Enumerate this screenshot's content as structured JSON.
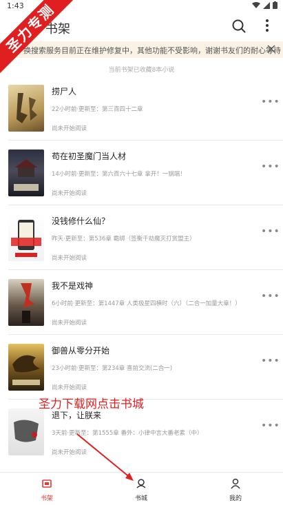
{
  "status": {
    "time": "1:43"
  },
  "appbar": {
    "title": "书架",
    "icons": [
      "search-icon",
      "more-vertical-icon"
    ]
  },
  "notice": {
    "text": "换搜索服务目前正在维护修复中，其他功能不受影响，谢谢书友们的耐心等待"
  },
  "shelf": {
    "count_text": "当前书架已收藏8本小说"
  },
  "books": [
    {
      "name": "捞尸人",
      "update": "22小时前·更新至：第三百四十二章",
      "state": "尚未开始阅读"
    },
    {
      "name": "苟在初圣魔门当人材",
      "update": "14小时前·更新至：第六百六十七章 拿开！一锅端！",
      "state": "尚未开始阅读"
    },
    {
      "name": "没钱修什么仙？",
      "update": "昨天·更新至：第536章 霸绑（签衡千劫魔灭打赏盟主）",
      "state": "尚未开始阅读"
    },
    {
      "name": "我不是戏神",
      "update": "6小时前·更新至：第1447章 人类极星四横时（六）（二合一加量大章！）",
      "state": "尚未开始阅读"
    },
    {
      "name": "御兽从零分开始",
      "update": "23小时前·更新至：第234章 喜前交流(二合一)",
      "state": "尚未开始阅读"
    },
    {
      "name": "退下，让朕来",
      "update": "3天前·更新至：第1555章 番外：小律中言大番老素（中）",
      "state": "尚未开始阅读"
    }
  ],
  "tabs": [
    {
      "label": "书架",
      "icon": "bookshelf-icon",
      "active": true
    },
    {
      "label": "书城",
      "icon": "bookstore-icon",
      "active": false
    },
    {
      "label": "我的",
      "icon": "profile-icon",
      "active": false
    }
  ],
  "watermark": {
    "text": "圣力专测"
  },
  "annotation": {
    "text": "圣力下载网点击书城"
  },
  "colors": {
    "accent": "#e53935",
    "notice_bg": "#fbf2e6",
    "annotation": "#e02020"
  }
}
